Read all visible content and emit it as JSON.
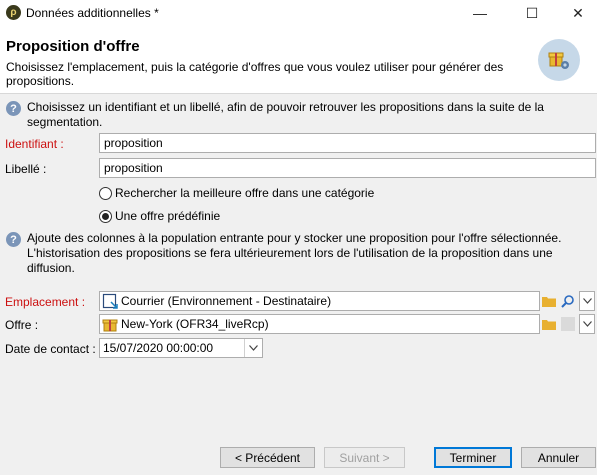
{
  "window": {
    "title": "Données additionnelles *",
    "minimize": "—",
    "maximize": "☐",
    "close": "✕"
  },
  "header": {
    "title": "Proposition d'offre",
    "description": "Choisissez l'emplacement, puis la catégorie d'offres que vous voulez utiliser pour générer des propositions."
  },
  "info1": "Choisissez un identifiant et un libellé, afin de pouvoir retrouver les propositions dans la suite de la segmentation.",
  "fields": {
    "identifiant_label": "Identifiant :",
    "identifiant_value": "proposition",
    "libelle_label": "Libellé :",
    "libelle_value": "proposition"
  },
  "radios": {
    "option1": "Rechercher la meilleure offre dans une catégorie",
    "option2": "Une offre prédéfinie",
    "selected": "option2"
  },
  "info2": "Ajoute des colonnes à la population entrante pour y stocker une proposition pour l'offre sélectionnée. L'historisation des propositions se fera ultérieurement lors de l'utilisation de la proposition dans une diffusion.",
  "placement": {
    "label": "Emplacement :",
    "value": "Courrier (Environnement - Destinataire)"
  },
  "offer": {
    "label": "Offre :",
    "value": "New-York (OFR34_liveRcp)"
  },
  "contact_date": {
    "label": "Date de contact :",
    "value": "15/07/2020 00:00:00"
  },
  "buttons": {
    "previous": "< Précédent",
    "next": "Suivant >",
    "finish": "Terminer",
    "cancel": "Annuler"
  },
  "colors": {
    "required_label": "#cc1010",
    "info_icon": "#7b95b8",
    "focus": "#0078d7"
  }
}
